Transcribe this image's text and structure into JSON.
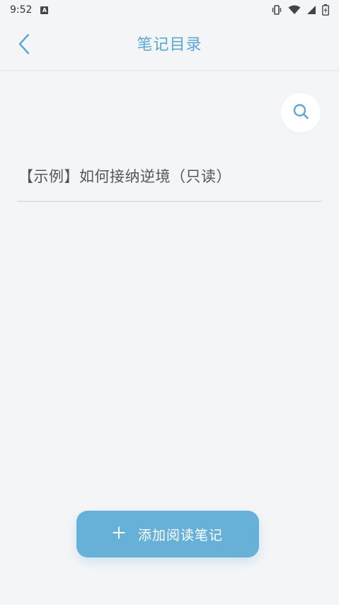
{
  "status_bar": {
    "time": "9:52",
    "notification_badge": "A",
    "icons": [
      "vibrate-icon",
      "wifi-icon",
      "signal-icon",
      "battery-charging-icon"
    ]
  },
  "nav": {
    "title": "笔记目录",
    "back_icon": "chevron-left-icon"
  },
  "search": {
    "icon": "search-icon"
  },
  "notes": [
    {
      "title": "【示例】如何接纳逆境（只读）"
    }
  ],
  "add_button": {
    "icon": "plus-icon",
    "label": "添加阅读笔记"
  },
  "colors": {
    "accent": "#5aa7d4",
    "button": "#67b0d7",
    "background": "#f4f5f7",
    "text": "#555555"
  }
}
